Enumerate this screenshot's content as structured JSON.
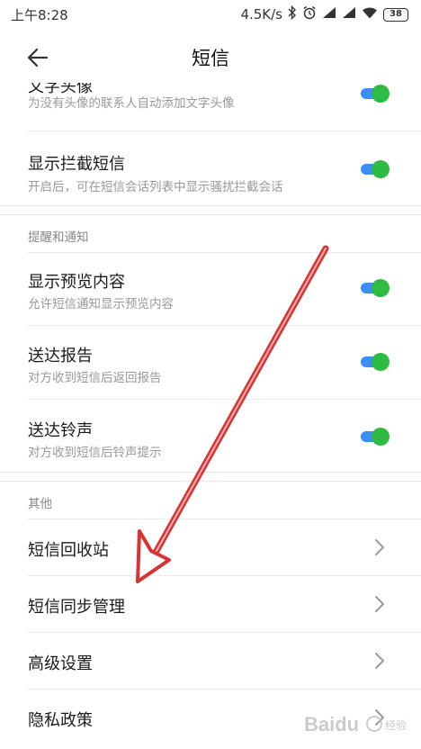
{
  "status_bar": {
    "time": "上午8:28",
    "network_speed": "4.5K/s",
    "battery": "38",
    "icons": [
      "bluetooth-icon",
      "alarm-icon",
      "signal-icon",
      "signal-icon",
      "wifi-icon",
      "battery-icon"
    ]
  },
  "header": {
    "title": "短信",
    "back_icon": "arrow-left-icon"
  },
  "sections": {
    "top": {
      "items": [
        {
          "title": "文字头像",
          "subtitle": "为没有头像的联系人自动添加文字头像",
          "toggle_on": true
        },
        {
          "title": "显示拦截短信",
          "subtitle": "开启后，可在短信会话列表中显示骚扰拦截会话",
          "toggle_on": true
        }
      ]
    },
    "notify": {
      "header": "提醒和通知",
      "items": [
        {
          "title": "显示预览内容",
          "subtitle": "允许短信通知显示预览内容",
          "toggle_on": true
        },
        {
          "title": "送达报告",
          "subtitle": "对方收到短信后返回报告",
          "toggle_on": true
        },
        {
          "title": "送达铃声",
          "subtitle": "对方收到短信后铃声提示",
          "toggle_on": true
        }
      ]
    },
    "other": {
      "header": "其他",
      "items": [
        {
          "title": "短信回收站"
        },
        {
          "title": "短信同步管理"
        },
        {
          "title": "高级设置"
        },
        {
          "title": "隐私政策"
        }
      ]
    }
  },
  "colors": {
    "toggle_track": "#3a8ef6",
    "toggle_knob": "#2dbb43",
    "annotation_arrow": "#d93232"
  },
  "watermark": "Baidu 经验"
}
